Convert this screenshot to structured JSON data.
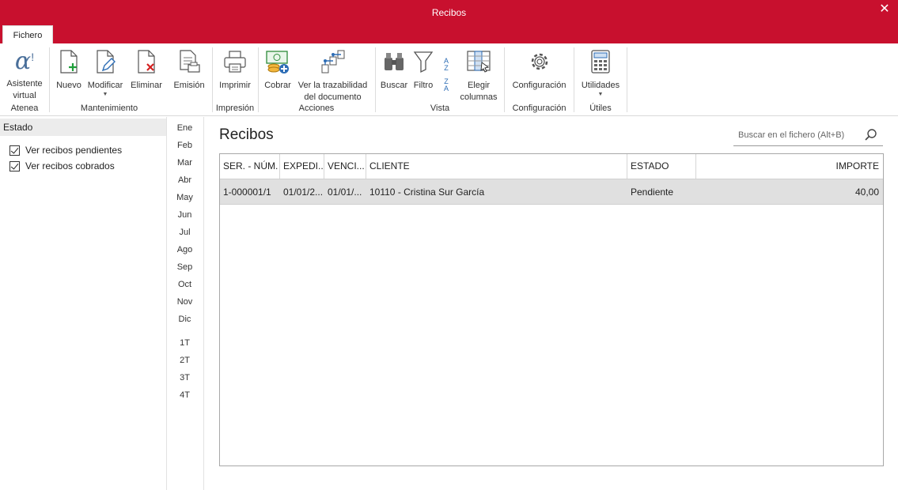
{
  "window": {
    "title": "Recibos"
  },
  "tabs": {
    "fichero": "Fichero"
  },
  "ribbon": {
    "groups": {
      "atenea": "Atenea",
      "mantenimiento": "Mantenimiento",
      "impresion": "Impresión",
      "acciones": "Acciones",
      "vista": "Vista",
      "configuracion": "Configuración",
      "utiles": "Útiles"
    },
    "buttons": {
      "asistente_1": "Asistente",
      "asistente_2": "virtual",
      "nuevo": "Nuevo",
      "modificar": "Modificar",
      "eliminar": "Eliminar",
      "emision": "Emisión",
      "imprimir": "Imprimir",
      "cobrar": "Cobrar",
      "trazabilidad_1": "Ver la trazabilidad",
      "trazabilidad_2": "del documento",
      "buscar": "Buscar",
      "filtro": "Filtro",
      "elegir_1": "Elegir",
      "elegir_2": "columnas",
      "configuracion": "Configuración",
      "utilidades": "Utilidades"
    }
  },
  "filters": {
    "header": "Estado",
    "pendientes": "Ver recibos pendientes",
    "cobrados": "Ver recibos cobrados"
  },
  "months": [
    "Ene",
    "Feb",
    "Mar",
    "Abr",
    "May",
    "Jun",
    "Jul",
    "Ago",
    "Sep",
    "Oct",
    "Nov",
    "Dic"
  ],
  "quarters": [
    "1T",
    "2T",
    "3T",
    "4T"
  ],
  "main": {
    "title": "Recibos",
    "search_placeholder": "Buscar en el fichero (Alt+B)"
  },
  "table": {
    "columns": [
      "SER. - NÚM.",
      "EXPEDI...",
      "VENCI...",
      "CLIENTE",
      "ESTADO",
      "IMPORTE"
    ],
    "rows": [
      [
        "1-000001/1",
        "01/01/2...",
        "01/01/...",
        "10110 - Cristina Sur García",
        "Pendiente",
        "40,00"
      ]
    ]
  },
  "colors": {
    "accent": "#c8102e",
    "selected_row": "#e0e0e0"
  }
}
